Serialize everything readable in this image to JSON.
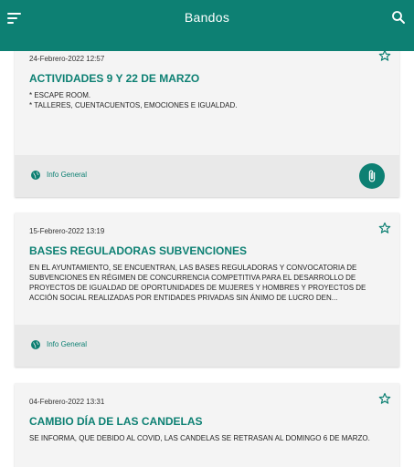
{
  "appbar": {
    "title": "Bandos"
  },
  "colors": {
    "primary": "#0d8073",
    "card": "#f4f4f4",
    "footer": "#e9e9e9"
  },
  "icons": {
    "menu": "menu-icon",
    "search": "search-icon",
    "favorite": "star-outline-icon",
    "category": "globe-icon",
    "attachment": "paperclip-icon"
  },
  "bandos": [
    {
      "date": "24-Febrero-2022 12:57",
      "title": "ACTIVIDADES 9 Y 22 DE MARZO",
      "text": "* ESCAPE ROOM.\n* TALLERES, CUENTACUENTOS, EMOCIONES E IGUALDAD.",
      "category": "Info General",
      "has_attachment": true
    },
    {
      "date": "15-Febrero-2022 13:19",
      "title": "BASES REGULADORAS SUBVENCIONES",
      "text": "EN EL AYUNTAMIENTO, SE ENCUENTRAN, LAS BASES REGULADORAS Y CONVOCATORIA DE SUBVENCIONES EN RÉGIMEN DE CONCURRENCIA COMPETITIVA PARA EL DESARROLLO DE PROYECTOS DE IGUALDAD DE OPORTUNIDADES DE MUJERES Y HOMBRES Y PROYECTOS DE ACCIÓN  SOCIAL REALIZADAS POR ENTIDADES PRIVADAS SIN ÁNIMO DE LUCRO DEN...",
      "category": "Info General",
      "has_attachment": false
    },
    {
      "date": "04-Febrero-2022 13:31",
      "title": "CAMBIO DÍA DE LAS CANDELAS",
      "text": "SE INFORMA, QUE DEBIDO AL COVID, LAS CANDELAS SE RETRASAN AL DOMINGO 6 DE MARZO.",
      "category": "",
      "has_attachment": false
    }
  ]
}
